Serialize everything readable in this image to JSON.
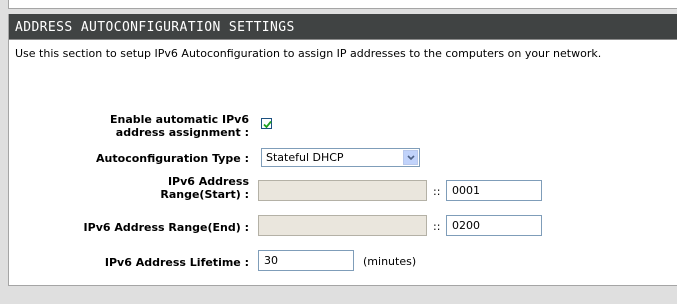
{
  "section": {
    "title": "ADDRESS AUTOCONFIGURATION SETTINGS",
    "description": "Use this section to setup IPv6 Autoconfiguration to assign IP addresses to the computers on your network."
  },
  "fields": {
    "enable_label_line1": "Enable automatic IPv6",
    "enable_label_line2": "address assignment :",
    "enable_checked": true,
    "type_label": "Autoconfiguration Type :",
    "type_value": "Stateful DHCP",
    "range_start_label_line1": "IPv6 Address",
    "range_start_label_line2": "Range(Start) :",
    "range_start_prefix": "",
    "range_start_separator": "::",
    "range_start_suffix": "0001",
    "range_end_label": "IPv6 Address Range(End) :",
    "range_end_prefix": "",
    "range_end_separator": "::",
    "range_end_suffix": "0200",
    "lifetime_label": "IPv6 Address Lifetime :",
    "lifetime_value": "30",
    "lifetime_unit": "(minutes)"
  },
  "icons": {
    "checkbox_check": "check-icon",
    "select_arrow": "chevron-down-icon"
  },
  "colors": {
    "header_bg": "#404343",
    "header_text": "#ffffff",
    "disabled_input_bg": "#eae6dd",
    "check_color": "#21a121"
  }
}
